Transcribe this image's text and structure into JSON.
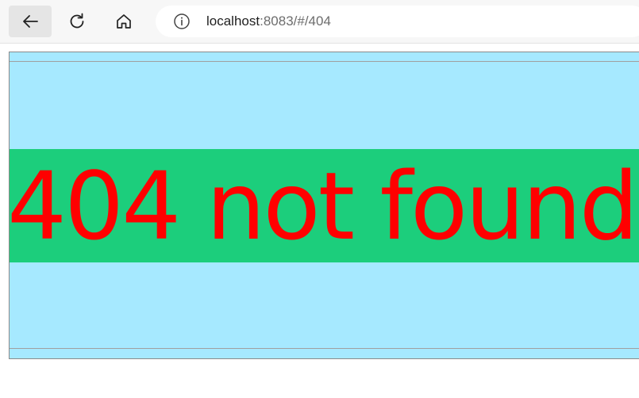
{
  "browser": {
    "url_host": "localhost",
    "url_rest": ":8083/#/404",
    "icons": {
      "back": "arrow-left-icon",
      "reload": "reload-icon",
      "home": "home-icon",
      "info": "info-icon"
    }
  },
  "page": {
    "message": "404 not found",
    "colors": {
      "background": "#a6e9ff",
      "banner": "#1cce7c",
      "message": "#ff0000"
    }
  }
}
